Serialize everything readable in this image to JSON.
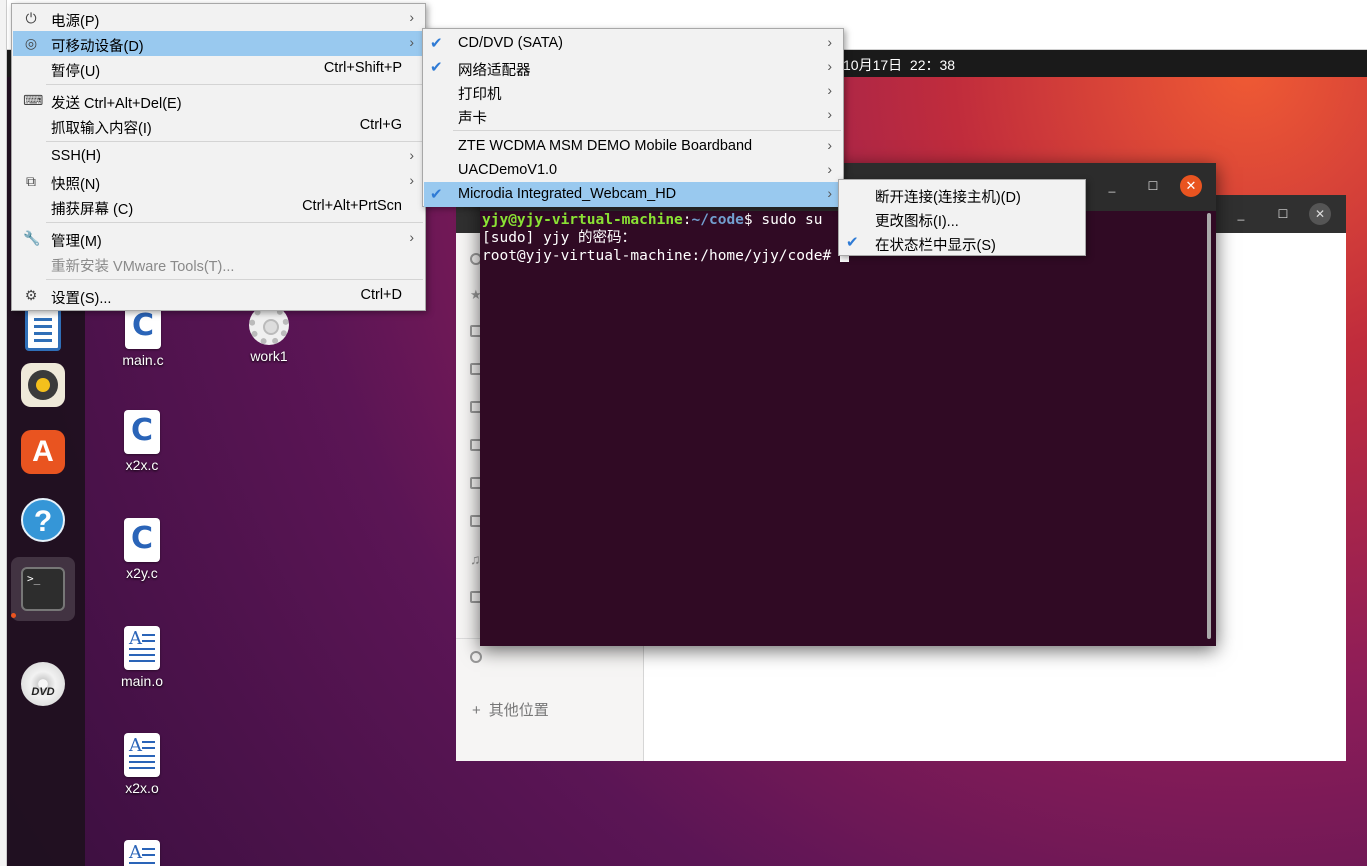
{
  "guest": {
    "clock": "10月17日  22：38",
    "desktop_icons": [
      {
        "label": "main.c",
        "glyph": "C"
      },
      {
        "label": "work1"
      },
      {
        "label": "x2x.c",
        "glyph": "C"
      },
      {
        "label": "x2y.c",
        "glyph": "C"
      },
      {
        "label": "main.o",
        "glyph": "A"
      },
      {
        "label": "x2x.o",
        "glyph": "A"
      },
      {
        "glyph": "A"
      }
    ],
    "dock": [
      {
        "icon": "writer-icon"
      },
      {
        "icon": "rhythmbox-icon"
      },
      {
        "icon": "software-store-icon",
        "glyph": "A"
      },
      {
        "icon": "help-icon",
        "glyph": "?"
      },
      {
        "icon": "terminal-icon",
        "glyph": ">_"
      },
      {
        "icon": "dvd-icon",
        "glyph": "DVD"
      }
    ],
    "files": {
      "other_locations": "其他位置",
      "plus": "+",
      "close_glyph": "✕"
    },
    "terminal": {
      "line1_user": "yjy@yjy-virtual-machine",
      "line1_sep": ":",
      "line1_path": "~/code",
      "line1_cmd": "$ sudo su",
      "line2": "[sudo] yjy 的密码：",
      "line3": "root@yjy-virtual-machine:/home/yjy/code# ",
      "close_glyph": "✕",
      "max_glyph": "☐",
      "min_glyph": "_"
    }
  },
  "menu_vm": {
    "items": [
      {
        "label": "电源(P)",
        "icon": "power-icon",
        "arrow": "›"
      },
      {
        "label": "可移动设备(D)",
        "icon": "removable-devices-icon",
        "arrow": "›"
      },
      {
        "label": "暂停(U)",
        "shortcut": "Ctrl+Shift+P"
      },
      {
        "label": "发送 Ctrl+Alt+Del(E)",
        "icon": "keyboard-icon"
      },
      {
        "label": "抓取输入内容(I)",
        "shortcut": "Ctrl+G"
      },
      {
        "label": "SSH(H)",
        "arrow": "›"
      },
      {
        "label": "快照(N)",
        "icon": "snapshot-icon",
        "arrow": "›"
      },
      {
        "label": "捕获屏幕 (C)",
        "shortcut": "Ctrl+Alt+PrtScn"
      },
      {
        "label": "管理(M)",
        "icon": "wrench-icon",
        "arrow": "›"
      },
      {
        "label": "重新安装 VMware Tools(T)..."
      },
      {
        "label": "设置(S)...",
        "icon": "settings-icon",
        "shortcut": "Ctrl+D"
      }
    ]
  },
  "menu_devices": {
    "check": "✔",
    "items": [
      {
        "label": "CD/DVD (SATA)",
        "checked": true,
        "arrow": "›"
      },
      {
        "label": "网络适配器",
        "checked": true,
        "arrow": "›"
      },
      {
        "label": "打印机",
        "arrow": "›"
      },
      {
        "label": "声卡",
        "arrow": "›"
      },
      {
        "label": "ZTE WCDMA MSM DEMO Mobile Boardband",
        "arrow": "›"
      },
      {
        "label": "UACDemoV1.0",
        "arrow": "›"
      },
      {
        "label": "Microdia Integrated_Webcam_HD",
        "checked": true,
        "arrow": "›"
      }
    ]
  },
  "menu_webcam": {
    "items": [
      {
        "label": "断开连接(连接主机)(D)"
      },
      {
        "label": "更改图标(I)..."
      },
      {
        "label": "在状态栏中显示(S)",
        "checked": true
      }
    ]
  },
  "colors": {
    "menu_highlight": "#99c9ef",
    "check": "#2f7bd5",
    "terminal_bg": "#300a24",
    "prompt_user": "#8ae234",
    "prompt_path": "#729fcf",
    "ubuntu_orange": "#e95420"
  }
}
